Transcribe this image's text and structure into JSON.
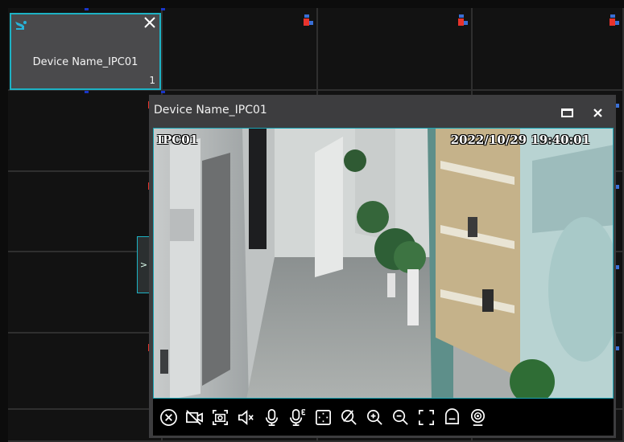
{
  "first_tile": {
    "device_name": "Device Name_IPC01",
    "channel_number": "1"
  },
  "popup": {
    "title": "Device Name_IPC01"
  },
  "video": {
    "camera_label": "IPC01",
    "timestamp": "2022/10/29  19:40:01"
  },
  "side_toggle": {
    "glyph": ">"
  },
  "toolbar": {
    "buttons": [
      "close-preview-icon",
      "record-off-icon",
      "snapshot-icon",
      "mute-icon",
      "microphone-icon",
      "intercom-icon",
      "digital-zoom-icon",
      "disable-icon",
      "zoom-in-icon",
      "zoom-out-icon",
      "fullscreen-icon",
      "stream-switch-icon",
      "ptz-icon"
    ]
  },
  "colors": {
    "accent": "#1db2c4",
    "record_red": "#e8332c",
    "record_blue": "#3a6fd6"
  },
  "icons": {
    "camera": "camera-icon",
    "close": "close-icon",
    "maximize": "maximize-icon",
    "record_status": "record-status-icon"
  }
}
